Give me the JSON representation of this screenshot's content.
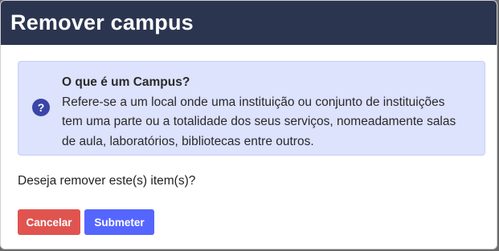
{
  "modal": {
    "title": "Remover campus",
    "info": {
      "icon": "question-icon",
      "icon_glyph": "?",
      "heading": "O que é um Campus?",
      "line1": "Refere-se a um local onde uma instituição ou conjunto de instituições",
      "line2": "tem uma parte ou a totalidade dos seus serviços, nomeadamente salas",
      "line3": "de aula, laboratórios, bibliotecas entre outros."
    },
    "question": "Deseja remover este(s) item(s)?",
    "buttons": {
      "cancel_label": "Cancelar",
      "submit_label": "Submeter"
    },
    "colors": {
      "header_bg": "#2b3550",
      "info_bg": "#dde2fd",
      "cancel": "#e05450",
      "submit": "#5566ff"
    }
  }
}
